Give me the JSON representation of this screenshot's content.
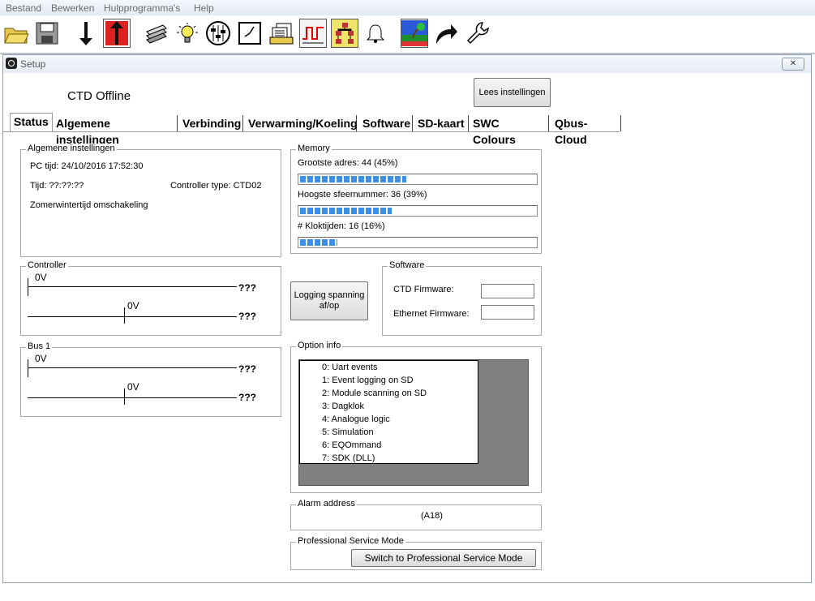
{
  "menu": [
    "Bestand",
    "Bewerken",
    "Hulpprogramma's",
    "Help"
  ],
  "toolbar": [
    "open-folder-icon",
    "save-disk-icon",
    "download-arrow-icon",
    "upload-arrow-icon",
    "stack-icon",
    "lightbulb-icon",
    "sliders-icon",
    "clock-icon",
    "documents-icon",
    "pulse-wave-icon",
    "network-icon",
    "bell-icon",
    "landscape-icon",
    "redo-arrow-icon",
    "wrench-icon"
  ],
  "window": {
    "title": "Setup",
    "close": "✕"
  },
  "header": {
    "status": "CTD Offline",
    "read_button": "Lees instellingen"
  },
  "tabs": [
    "Status",
    "Algemene instellingen",
    "Verbinding",
    "Verwarming/Koeling",
    "Software",
    "SD-kaart",
    "SWC Colours",
    "Qbus-Cloud"
  ],
  "general": {
    "legend": "Algemene instellingen",
    "pc_time": "PC tijd: 24/10/2016  17:52:30",
    "time": "Tijd: ??:??:??",
    "controller_type": "Controller type: CTD02",
    "dst": "Zomerwintertijd omschakeling"
  },
  "memory": {
    "legend": "Memory",
    "items": [
      {
        "label": "Grootste adres: 44 (45%)",
        "percent": 45
      },
      {
        "label": "Hoogste sfeernummer: 36 (39%)",
        "percent": 39
      },
      {
        "label": "# Kloktijden: 16 (16%)",
        "percent": 16
      }
    ]
  },
  "controller": {
    "legend": "Controller",
    "v1": "0V",
    "v2": "0V",
    "q1": "???",
    "q2": "???"
  },
  "bus1": {
    "legend": "Bus 1",
    "v1": "0V",
    "v2": "0V",
    "q1": "???",
    "q2": "???"
  },
  "logging_button": "Logging spanning af/op",
  "software": {
    "legend": "Software",
    "ctd_firmware": "CTD Firmware:",
    "ethernet_firmware": "Ethernet Firmware:",
    "ctd_value": "",
    "ethernet_value": ""
  },
  "option_info": {
    "legend": "Option info",
    "items": [
      "0: Uart events",
      "1: Event logging on SD",
      "2: Module scanning on SD",
      "3: Dagklok",
      "4: Analogue logic",
      "5: Simulation",
      "6: EQOmmand",
      "7: SDK (DLL)"
    ]
  },
  "alarm": {
    "legend": "Alarm address",
    "value": "(A18)"
  },
  "psm": {
    "legend": "Professional Service Mode",
    "button": "Switch to Professional Service Mode"
  }
}
